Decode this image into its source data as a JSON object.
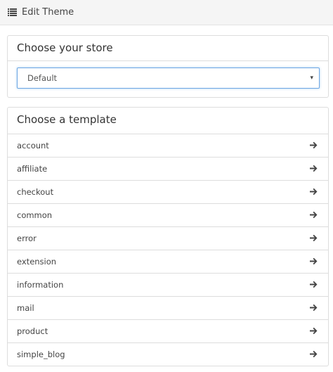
{
  "header": {
    "title": "Edit Theme",
    "icon": "list-icon"
  },
  "store_panel": {
    "title": "Choose your store",
    "select": {
      "selected": "Default",
      "caret": "▾"
    }
  },
  "template_panel": {
    "title": "Choose a template",
    "arrow_icon": "arrow-right-icon",
    "items": [
      {
        "label": "account"
      },
      {
        "label": "affiliate"
      },
      {
        "label": "checkout"
      },
      {
        "label": "common"
      },
      {
        "label": "error"
      },
      {
        "label": "extension"
      },
      {
        "label": "information"
      },
      {
        "label": "mail"
      },
      {
        "label": "product"
      },
      {
        "label": "simple_blog"
      }
    ]
  },
  "colors": {
    "header_bg": "#f5f5f5",
    "border": "#dddddd",
    "focus_border": "#6fa7e3",
    "text": "#333333"
  }
}
